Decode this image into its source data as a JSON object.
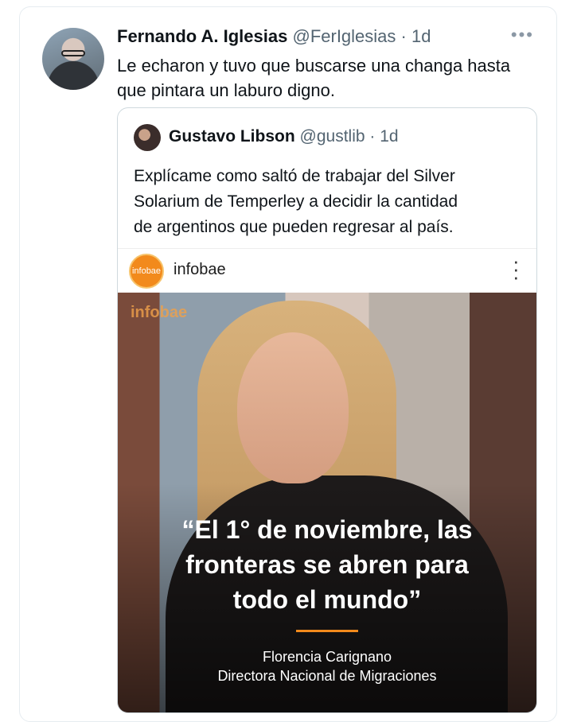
{
  "tweet": {
    "name": "Fernando A. Iglesias",
    "handle": "@FerIglesias",
    "separator": "·",
    "time": "1d",
    "more": "•••",
    "text_line1": "Le echaron y tuvo que buscarse una changa hasta",
    "text_line2": "que pintara un laburo digno."
  },
  "quoted": {
    "name": "Gustavo Libson",
    "handle": "@gustlib",
    "separator": "·",
    "time": "1d",
    "text_line1": "Explícame como saltó de trabajar del Silver",
    "text_line2": "Solarium de Temperley a decidir la cantidad",
    "text_line3": "de argentinos que pueden regresar al país."
  },
  "card": {
    "logo_text": "infobae",
    "source_name": "infobae",
    "menu_icon": "vertical-dots-icon",
    "watermark": "infobae",
    "quote_line1": "“El 1° de noviembre, las",
    "quote_line2": "fronteras se abren para",
    "quote_line3": "todo el mundo”",
    "person_name": "Florencia Carignano",
    "person_title": "Directora Nacional de Migraciones"
  },
  "colors": {
    "accent": "#f28a1c",
    "muted_text": "#536471",
    "border": "#cfd9de"
  }
}
